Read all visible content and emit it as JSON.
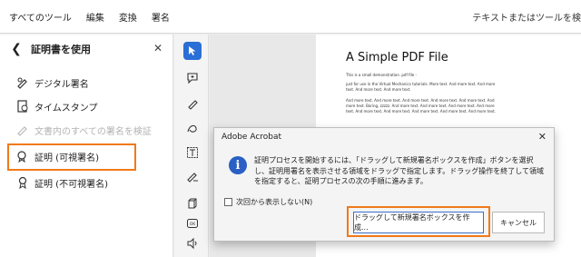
{
  "menubar": {
    "items": [
      "すべてのツール",
      "編集",
      "変換",
      "署名"
    ],
    "search": "テキストまたはツールを検"
  },
  "panel": {
    "title": "証明書を使用",
    "tools": [
      {
        "label": "デジタル署名",
        "icon": "pen-sign-icon"
      },
      {
        "label": "タイムスタンプ",
        "icon": "timestamp-icon"
      },
      {
        "label": "文書内のすべての署名を検証",
        "icon": "verify-signatures-icon",
        "disabled": true
      },
      {
        "label": "証明 (可視署名)",
        "icon": "certify-visible-icon"
      },
      {
        "label": "証明 (不可視署名)",
        "icon": "certify-invisible-icon"
      }
    ]
  },
  "document": {
    "title": "A Simple PDF File",
    "paragraphs": [
      "This is a small demonstration .pdf file -",
      "just for use in the Virtual Mechanics tutorials. More text. And more text. And more text. And more text. And more text.",
      "And more text. And more text. And more text. And more text. And more text. And more text. Boring, zzzzz. And more text. And more text. And more text. And more text. And more text. And more text. And more text. And more text. And more text."
    ]
  },
  "dialog": {
    "title": "Adobe Acrobat",
    "message": "証明プロセスを開始するには、「ドラッグして新規署名ボックスを作成」ボタンを選択し、証明用署名を表示させる領域をドラッグで指定します。ドラッグ操作を終了して領域を指定すると、証明プロセスの次の手順に進みます。",
    "checkbox_label": "次回から表示しない(N)",
    "primary_button": "ドラッグして新規署名ボックスを作成...",
    "cancel_button": "キャンセル"
  },
  "colors": {
    "highlight": "#f07a1a",
    "accent": "#2a6fd6"
  }
}
